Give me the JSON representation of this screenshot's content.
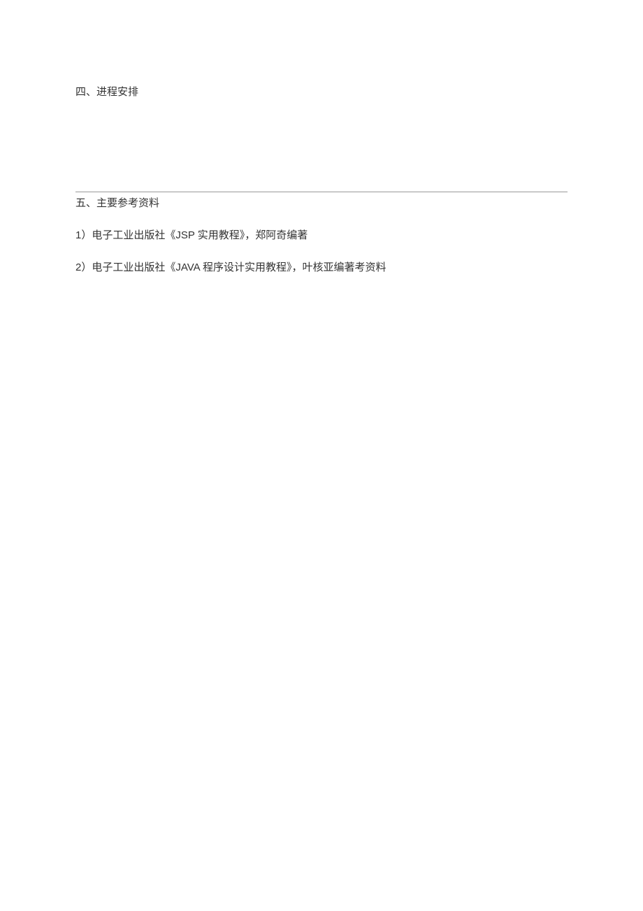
{
  "sections": {
    "schedule": {
      "heading": "四、进程安排"
    },
    "references": {
      "heading": "五、主要参考资料",
      "items": [
        "1）电子工业出版社《JSP 实用教程》，郑阿奇编著",
        "2）电子工业出版社《JAVA 程序设计实用教程》，叶核亚编著考资料"
      ]
    }
  }
}
